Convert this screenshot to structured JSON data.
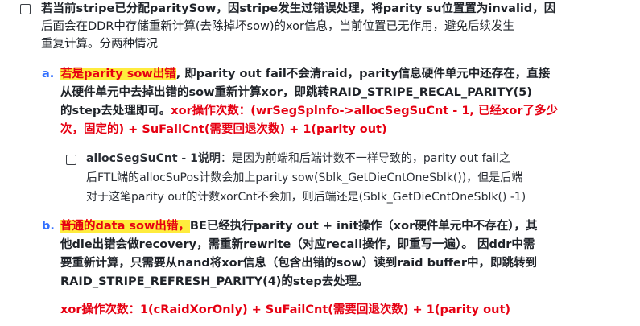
{
  "item1": {
    "checked": false,
    "lines": [
      "若当前stripe已分配paritySow，因stripe发生过错误处理，将parity su位置置为invalid，因",
      "后面会在DDR中存储重新计算(去除掉坏sow)的xor信息，当前位置已无作用，避免后续发生",
      "重复计算。分两种情况"
    ]
  },
  "case_a": {
    "marker": "a.",
    "highlight": "若是parity sow出错",
    "line1_rest": ", 即parity out fail不会清raid，parity信息硬件单元中还存在，直接",
    "line2": "从硬件单元中去掉出错的sow重新计算xor，即跳转RAID_STRIPE_RECAL_PARITY(5)",
    "line3_black": "的step去处理即可。",
    "line3_red": "xor操作次数：(wrSegSplnfo->allocSegSuCnt - 1, 已经xor了多少",
    "line4_red": "次，固定的) + SuFailCnt(需要回退次数) + 1(parity out)"
  },
  "note": {
    "checked": false,
    "bold": "allocSegSuCnt - 1说明",
    "line1_rest": "：是因为前端和后端计数不一样导致的，parity out fail之",
    "line2": "后FTL端的allocSuPos计数会加上parity sow(Sblk_GetDieCntOneSblk())，但是后端",
    "line3": "对于这笔parity out的计数xorCnt不会加，则后端还是(Sblk_GetDieCntOneSblk() -1)"
  },
  "case_b": {
    "marker": "b.",
    "highlight": "普通的data sow出错，",
    "line1_rest": "BE已经执行parity out + init操作（xor硬件单元中不存在），其",
    "line2": "他die出错会做recovery，需重新rewrite（对应recall操作，即重写一遍）。 因ddr中需",
    "line3": "要重新计算，只需要从nand将xor信息（包含出错的sow）读到raid buffer中，即跳转到",
    "line4": "RAID_STRIPE_REFRESH_PARITY(4)的step去处理。",
    "xor_line": "xor操作次数：1(cRaidXorOnly) + SuFailCnt(需要回退次数) + 1(parity out)"
  }
}
